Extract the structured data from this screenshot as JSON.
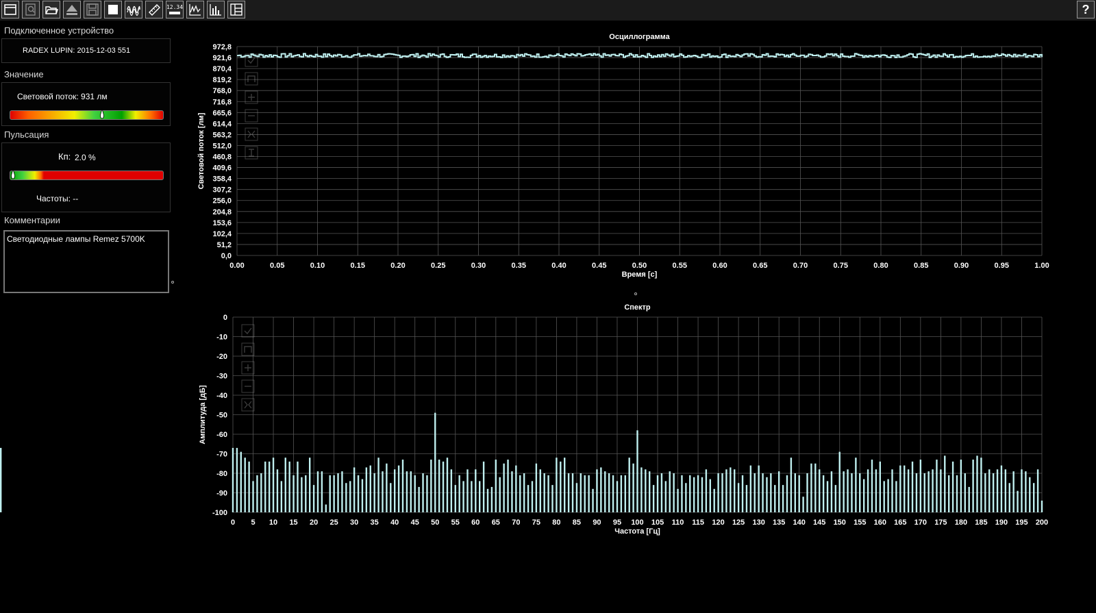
{
  "toolbar": {
    "buttons": [
      {
        "icon": "window-icon"
      },
      {
        "icon": "search-icon"
      },
      {
        "icon": "folder-open-icon"
      },
      {
        "icon": "eject-icon"
      },
      {
        "icon": "save-icon"
      },
      {
        "icon": "stop-icon"
      },
      {
        "icon": "waveform-icon"
      },
      {
        "icon": "ruler-icon"
      },
      {
        "icon": "numeric-display-icon",
        "text": "12.34"
      },
      {
        "icon": "oscillogram-icon"
      },
      {
        "icon": "spectrum-icon"
      },
      {
        "icon": "layout-icon"
      }
    ],
    "help_icon": "help-icon",
    "help_text": "?"
  },
  "device": {
    "title": "Подключенное устройство",
    "name": "RADEX LUPIN: 2015-12-03 551"
  },
  "value": {
    "title": "Значение",
    "label": "Световой поток: 931 лм",
    "indicator_fraction": 0.6
  },
  "pulsation": {
    "title": "Пульсация",
    "kp_label": "Кп:",
    "kp_value": "2.0 %",
    "indicator_fraction": 0.02,
    "freq_label": "Частоты: --"
  },
  "comments": {
    "title": "Комментарии",
    "text": "Светодиодные лампы Remez 5700K"
  },
  "chart_data": [
    {
      "type": "line",
      "title": "Осциллограмма",
      "xlabel": "Время [с]",
      "ylabel": "Световой поток [лм]",
      "xlim": [
        0,
        1.0
      ],
      "ylim": [
        0,
        972.8
      ],
      "xticks": [
        "0.00",
        "0.05",
        "0.10",
        "0.15",
        "0.20",
        "0.25",
        "0.30",
        "0.35",
        "0.40",
        "0.45",
        "0.50",
        "0.55",
        "0.60",
        "0.65",
        "0.70",
        "0.75",
        "0.80",
        "0.85",
        "0.90",
        "0.95",
        "1.00"
      ],
      "yticks": [
        "972,8",
        "921,6",
        "870,4",
        "819,2",
        "768,0",
        "716,8",
        "665,6",
        "614,4",
        "563,2",
        "512,0",
        "460,8",
        "409,6",
        "358,4",
        "307,2",
        "256,0",
        "204,8",
        "153,6",
        "102,4",
        "51,2",
        "0,0"
      ],
      "grid": true,
      "series": [
        {
          "color": "#bfefef",
          "baseline": 931,
          "ripple": 9
        }
      ]
    },
    {
      "type": "bar",
      "title": "Спектр",
      "xlabel": "Частота [Гц]",
      "ylabel": "Амплитуда [дБ]",
      "xlim": [
        0,
        200
      ],
      "ylim": [
        -100,
        0
      ],
      "xticks": [
        "0",
        "5",
        "10",
        "15",
        "20",
        "25",
        "30",
        "35",
        "40",
        "45",
        "50",
        "55",
        "60",
        "65",
        "70",
        "75",
        "80",
        "85",
        "90",
        "95",
        "100",
        "105",
        "110",
        "115",
        "120",
        "125",
        "130",
        "135",
        "140",
        "145",
        "150",
        "155",
        "160",
        "165",
        "170",
        "175",
        "180",
        "185",
        "190",
        "195",
        "200"
      ],
      "yticks": [
        "0",
        "-10",
        "-20",
        "-30",
        "-40",
        "-50",
        "-60",
        "-70",
        "-80",
        "-90",
        "-100"
      ],
      "grid": true,
      "bar_color": "#bfefef",
      "x": [
        0,
        1,
        2,
        3,
        4,
        5,
        6,
        7,
        8,
        9,
        10,
        11,
        12,
        13,
        14,
        15,
        16,
        17,
        18,
        19,
        20,
        21,
        22,
        23,
        24,
        25,
        26,
        27,
        28,
        29,
        30,
        31,
        32,
        33,
        34,
        35,
        36,
        37,
        38,
        39,
        40,
        41,
        42,
        43,
        44,
        45,
        46,
        47,
        48,
        49,
        50,
        51,
        52,
        53,
        54,
        55,
        56,
        57,
        58,
        59,
        60,
        61,
        62,
        63,
        64,
        65,
        66,
        67,
        68,
        69,
        70,
        71,
        72,
        73,
        74,
        75,
        76,
        77,
        78,
        79,
        80,
        81,
        82,
        83,
        84,
        85,
        86,
        87,
        88,
        89,
        90,
        91,
        92,
        93,
        94,
        95,
        96,
        97,
        98,
        99,
        100,
        101,
        102,
        103,
        104,
        105,
        106,
        107,
        108,
        109,
        110,
        111,
        112,
        113,
        114,
        115,
        116,
        117,
        118,
        119,
        120,
        121,
        122,
        123,
        124,
        125,
        126,
        127,
        128,
        129,
        130,
        131,
        132,
        133,
        134,
        135,
        136,
        137,
        138,
        139,
        140,
        141,
        142,
        143,
        144,
        145,
        146,
        147,
        148,
        149,
        150,
        151,
        152,
        153,
        154,
        155,
        156,
        157,
        158,
        159,
        160,
        161,
        162,
        163,
        164,
        165,
        166,
        167,
        168,
        169,
        170,
        171,
        172,
        173,
        174,
        175,
        176,
        177,
        178,
        179,
        180,
        181,
        182,
        183,
        184,
        185,
        186,
        187,
        188,
        189,
        190,
        191,
        192,
        193,
        194,
        195,
        196,
        197,
        198,
        199,
        200
      ],
      "values": [
        -67,
        -67,
        -69,
        -72,
        -74,
        -84,
        -81,
        -80,
        -74,
        -74,
        -72,
        -78,
        -84,
        -72,
        -74,
        -81,
        -74,
        -82,
        -81,
        -72,
        -86,
        -79,
        -79,
        -96,
        -81,
        -81,
        -80,
        -79,
        -85,
        -84,
        -77,
        -81,
        -83,
        -77,
        -76,
        -80,
        -72,
        -79,
        -75,
        -85,
        -78,
        -76,
        -73,
        -79,
        -79,
        -81,
        -87,
        -80,
        -81,
        -73,
        -49,
        -73,
        -74,
        -72,
        -78,
        -86,
        -81,
        -84,
        -78,
        -84,
        -78,
        -84,
        -74,
        -88,
        -87,
        -73,
        -82,
        -75,
        -73,
        -79,
        -76,
        -81,
        -80,
        -86,
        -84,
        -75,
        -78,
        -80,
        -81,
        -86,
        -72,
        -74,
        -72,
        -80,
        -80,
        -85,
        -80,
        -81,
        -81,
        -88,
        -78,
        -77,
        -79,
        -80,
        -81,
        -84,
        -81,
        -81,
        -72,
        -75,
        -58,
        -77,
        -78,
        -79,
        -86,
        -81,
        -80,
        -84,
        -79,
        -80,
        -88,
        -81,
        -85,
        -81,
        -82,
        -81,
        -82,
        -78,
        -83,
        -88,
        -80,
        -80,
        -78,
        -77,
        -78,
        -85,
        -81,
        -86,
        -76,
        -80,
        -76,
        -80,
        -82,
        -80,
        -86,
        -79,
        -86,
        -81,
        -72,
        -80,
        -81,
        -92,
        -80,
        -75,
        -75,
        -78,
        -81,
        -84,
        -79,
        -86,
        -69,
        -79,
        -78,
        -80,
        -72,
        -80,
        -83,
        -78,
        -73,
        -78,
        -74,
        -84,
        -83,
        -78,
        -84,
        -76,
        -76,
        -78,
        -74,
        -80,
        -73,
        -80,
        -79,
        -78,
        -73,
        -78,
        -71,
        -81,
        -74,
        -81,
        -73,
        -80,
        -87,
        -73,
        -71,
        -72,
        -80,
        -78,
        -80,
        -78,
        -76,
        -78,
        -85,
        -79,
        -89,
        -78,
        -79,
        -82,
        -85,
        -78,
        -94,
        -67
      ]
    }
  ]
}
